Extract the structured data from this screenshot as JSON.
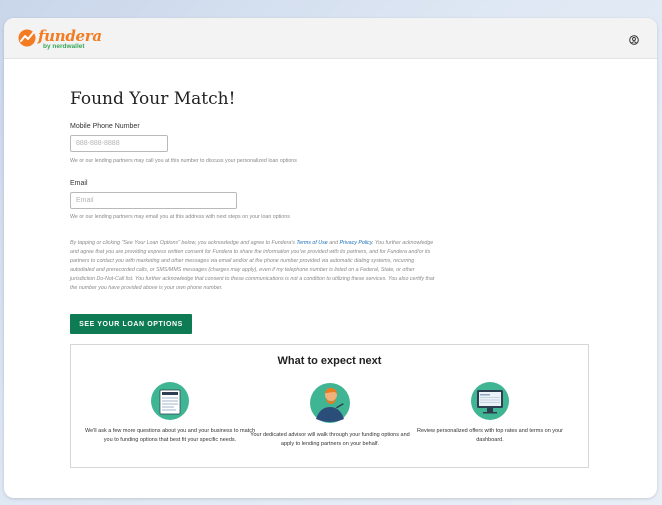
{
  "header": {
    "brand": "fundera",
    "brand_sub": "by nerdwallet"
  },
  "page": {
    "title": "Found Your Match!"
  },
  "phone": {
    "label": "Mobile Phone Number",
    "placeholder": "888-888-8888",
    "help": "We or our lending partners may call you at this number to discuss your personalized loan options"
  },
  "email": {
    "label": "Email",
    "placeholder": "Email",
    "help": "We or our lending partners may email you at this address with next steps on your loan options"
  },
  "consent": {
    "before": "By tapping or clicking \"See Your Loan Options\" below, you acknowledge and agree to Fundera's ",
    "terms_link": "Terms of Use",
    "and": " and ",
    "privacy_link": "Privacy Policy",
    "after": ". You further acknowledge and agree that you are providing express written consent for Fundera to share the information you've provided with its partners, and for Fundera and/or its partners to contact you with marketing and other messages via email and/or at the phone number provided via automatic dialing systems, recurring autodialed and prerecorded calls, or SMS/MMS messages (charges may apply), even if my telephone number is listed on a Federal, State, or other jurisdiction Do-Not-Call list. You further acknowledge that consent to these communications is not a condition to utilizing these services. You also certify that the number you have provided above is your own phone number."
  },
  "cta": {
    "label": "SEE YOUR LOAN OPTIONS"
  },
  "expect": {
    "title": "What to expect next",
    "steps": [
      {
        "icon": "questionnaire-document-icon",
        "text": "We'll ask a few more questions about you and your business to match you to funding options that best fit your specific needs."
      },
      {
        "icon": "advisor-person-icon",
        "text": "Your dedicated advisor will walk through your funding options and apply to lending partners on your behalf."
      },
      {
        "icon": "dashboard-monitor-icon",
        "text": "Review personalized offers with top rates and terms on your dashboard."
      }
    ]
  },
  "colors": {
    "brand_orange": "#f37b21",
    "brand_green": "#3aa657",
    "cta_green": "#0f7b54",
    "link_blue": "#1a6fb7",
    "illustration_teal": "#3fb593"
  }
}
